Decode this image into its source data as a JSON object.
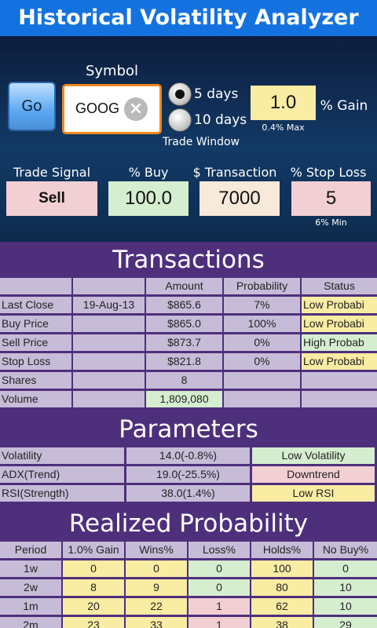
{
  "title": "Historical Volatility Analyzer",
  "controls": {
    "symbol_label": "Symbol",
    "go_label": "Go",
    "symbol_value": "GOOG",
    "radio_5": "5 days",
    "radio_10": "10 days",
    "trade_window_label": "Trade Window",
    "gain_value": "1.0",
    "gain_label": "% Gain",
    "gain_max": "0.4% Max",
    "trade_signal_label": "Trade Signal",
    "buy_label": "% Buy",
    "transaction_label": "$ Transaction",
    "stop_loss_label": "% Stop Loss",
    "trade_signal_value": "Sell",
    "buy_value": "100.0",
    "transaction_value": "7000",
    "stop_loss_value": "5",
    "stop_loss_min": "6% Min"
  },
  "transactions": {
    "heading": "Transactions",
    "columns": [
      "",
      "",
      "Amount",
      "Probability",
      "Status"
    ],
    "rows": [
      [
        "Last Close",
        "19-Aug-13",
        "$865.6",
        "7%",
        "Low Probabi"
      ],
      [
        "Buy Price",
        "",
        "$865.0",
        "100%",
        "Low Probabi"
      ],
      [
        "Sell Price",
        "",
        "$873.7",
        "0%",
        "High Probab"
      ],
      [
        "Stop Loss",
        "",
        "$821.8",
        "0%",
        "Low Probabi"
      ],
      [
        "Shares",
        "",
        "8",
        "",
        ""
      ],
      [
        "Volume",
        "",
        "1,809,080",
        "",
        ""
      ]
    ]
  },
  "parameters": {
    "heading": "Parameters",
    "rows": [
      [
        "Volatility",
        "14.0(-0.8%)",
        "Low Volatility"
      ],
      [
        "ADX(Trend)",
        "19.0(-25.5%)",
        "Downtrend"
      ],
      [
        "RSI(Strength)",
        "38.0(1.4%)",
        "Low RSI"
      ]
    ]
  },
  "realized": {
    "heading": "Realized Probability",
    "columns": [
      "Period",
      "1.0% Gain",
      "Wins%",
      "Loss%",
      "Holds%",
      "No Buy%"
    ],
    "rows": [
      [
        "1w",
        "0",
        "0",
        "0",
        "100",
        "0"
      ],
      [
        "2w",
        "8",
        "9",
        "0",
        "80",
        "10"
      ],
      [
        "1m",
        "20",
        "22",
        "1",
        "62",
        "10"
      ],
      [
        "2m",
        "23",
        "33",
        "1",
        "38",
        "29"
      ]
    ]
  }
}
